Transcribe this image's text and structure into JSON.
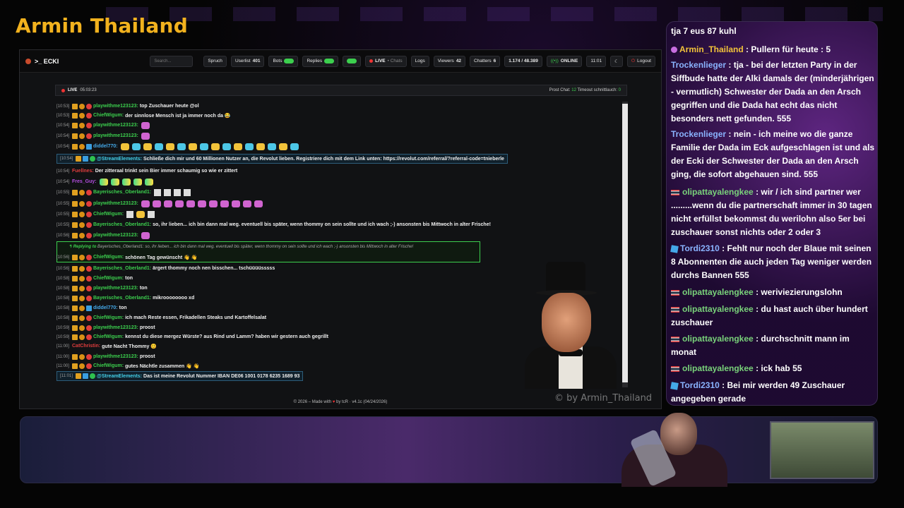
{
  "stage_title": "Armin Thailand",
  "watermark": "© by Armin_Thailand",
  "app": {
    "logo": ">_ ECKI",
    "search_placeholder": "Search...",
    "buttons": {
      "spruch": "Spruch",
      "userlist": "Userlist",
      "userlist_count": "401",
      "bots": "Bots",
      "replies": "Replies",
      "live": "LIVE",
      "chats": "• Chats",
      "logs": "Logs",
      "viewers": "Viewers",
      "viewers_count": "42",
      "chatters": "Chatters",
      "chatters_count": "6",
      "messages": "1.174 / 48.389",
      "status": "ONLINE",
      "time": "11:01",
      "logout": "Logout"
    },
    "chat_header": {
      "live_label": "LIVE",
      "live_time": "05:03:23",
      "info_prefix": "Prost Chat:",
      "info_value": "12",
      "info_suffix": "Timeout schnittlauch:",
      "info_value2": "0"
    },
    "footer": {
      "prefix": "© 2026 – Made with",
      "heart": "♥",
      "suffix": "by tcR · v4.1c (04/24/2026)"
    }
  },
  "messages": [
    {
      "ts": "[10:53]",
      "user": "playwithme123123",
      "color": "#3ccf4e",
      "text": "top Zuschauer heute @ol"
    },
    {
      "ts": "[10:53]",
      "user": "ChiefWigum",
      "color": "#3ccf4e",
      "text": "der sinnlose Mensch ist ja immer noch da 😂"
    },
    {
      "ts": "[10:54]",
      "user": "playwithme123123",
      "color": "#3ccf4e",
      "text": ""
    },
    {
      "ts": "[10:54]",
      "user": "playwithme123123",
      "color": "#3ccf4e",
      "text": ""
    },
    {
      "ts": "[10:54]",
      "user": "diddel770",
      "color": "#44a8e8",
      "text": ""
    },
    {
      "ts": "[10:54]",
      "user": "@StreamElements",
      "color": "#44d0e8",
      "text": "Schließe dich mir und 60 Millionen Nutzer an, die Revolut lieben. Registriere dich mit dem Link unten: https://revolut.com/referral/?referral-code=tnieberle"
    },
    {
      "ts": "[10:54]",
      "user": "Fuellnes",
      "color": "#e03d3d",
      "text": "Der zitteraal trinkt sein Bier immer schaumig so wie er zittert"
    },
    {
      "ts": "[10:54]",
      "user": "Fres_Guy",
      "color": "#b34de0",
      "text": ""
    },
    {
      "ts": "[10:55]",
      "user": "Bayerisches_Oberland1",
      "color": "#3ccf4e",
      "text": ""
    },
    {
      "ts": "[10:55]",
      "user": "playwithme123123",
      "color": "#3ccf4e",
      "text": ""
    },
    {
      "ts": "[10:55]",
      "user": "ChiefWigum",
      "color": "#3ccf4e",
      "text": ""
    },
    {
      "ts": "[10:55]",
      "user": "Bayerisches_Oberland1",
      "color": "#3ccf4e",
      "text": "so, ihr lieben... ich bin dann mal weg. eventuell bis später, wenn thommy on sein sollte und ich wach ;-) ansonsten bis Mittwoch in alter Frische!"
    },
    {
      "ts": "[10:56]",
      "user": "playwithme123123",
      "color": "#3ccf4e",
      "text": ""
    },
    {
      "ts": "[10:56]",
      "user": "ChiefWigum",
      "color": "#3ccf4e",
      "text": "schönen Tag gewünscht 👋 👋"
    },
    {
      "ts": "[10:56]",
      "user": "Bayerisches_Oberland1",
      "color": "#3ccf4e",
      "text": "ärgert thommy noch nen bisschen... tschüüüüsssss"
    },
    {
      "ts": "[10:58]",
      "user": "ChiefWigum",
      "color": "#3ccf4e",
      "text": "ton"
    },
    {
      "ts": "[10:58]",
      "user": "playwithme123123",
      "color": "#3ccf4e",
      "text": "ton"
    },
    {
      "ts": "[10:58]",
      "user": "Bayerisches_Oberland1",
      "color": "#3ccf4e",
      "text": "mikroooooooo xd"
    },
    {
      "ts": "[10:58]",
      "user": "diddel770",
      "color": "#44a8e8",
      "text": "ton"
    },
    {
      "ts": "[10:58]",
      "user": "ChiefWigum",
      "color": "#3ccf4e",
      "text": "ich mach Reste essen, Frikadellen Steaks und Kartoffelsalat"
    },
    {
      "ts": "[10:59]",
      "user": "playwithme123123",
      "color": "#3ccf4e",
      "text": "proost"
    },
    {
      "ts": "[10:59]",
      "user": "ChiefWigum",
      "color": "#3ccf4e",
      "text": "kennst du diese mergez Würste? aus Rind und Lamm? haben wir gestern auch gegrillt"
    },
    {
      "ts": "[11:00]",
      "user": "CatChristin",
      "color": "#e03d3d",
      "text": "gute Nacht Thommy 😊"
    },
    {
      "ts": "[11:00]",
      "user": "playwithme123123",
      "color": "#3ccf4e",
      "text": "proost"
    },
    {
      "ts": "[11:00]",
      "user": "ChiefWigum",
      "color": "#3ccf4e",
      "text": "gutes Nächtle zusammen 👋 👋"
    },
    {
      "ts": "[11:01]",
      "user": "@StreamElements",
      "color": "#44d0e8",
      "text": "Das ist meine Revolut Nummer IBAN DE06 1001 0178 6235 1689 93"
    }
  ],
  "reply": {
    "label": "Replying to",
    "target": "Bayerisches_Oberland1",
    "quote": ": so, ihr lieben... ich bin dann mal weg. eventuell bis später, wenn thommy on sein sollte und ich wach ;-) ansonsten bis Mittwoch in alter Frische!"
  },
  "overlay": [
    {
      "user": "",
      "color": "#fff",
      "text": "tja 7 eus 87 kuhl"
    },
    {
      "user": "Armin_Thailand",
      "color": "#f2c33a",
      "text": ": Pullern für heute : 5"
    },
    {
      "user": "Trockenlieger",
      "color": "#8ab4ff",
      "text": ": tja - bei der letzten Party in der Siffbude hatte der Alki damals der (minderjährigen - vermutlich) Schwester der Dada an den Arsch gegriffen und die Dada hat echt das nicht besonders nett gefunden. 555"
    },
    {
      "user": "Trockenlieger",
      "color": "#8ab4ff",
      "text": ": nein - ich meine wo die ganze Familie der Dada im Eck aufgeschlagen ist und als der Ecki der Schwester der Dada an den Arsch ging, die sofort abgehauen sind. 555"
    },
    {
      "user": "olipattayalengkee",
      "color": "#79d27a",
      "text": ": wir / ich sind partner wer .........wenn du die partnerschaft immer in 30 tagen nicht erfüllst bekommst du werilohn also 5er bei zuschauer sonst nichts oder 2 oder 3"
    },
    {
      "user": "Tordi2310",
      "color": "#8ab4ff",
      "text": ": Fehlt nur noch der Blaue mit seinen 8 Abonnenten die auch jeden Tag weniger werden durchs Bannen 555"
    },
    {
      "user": "olipattayalengkee",
      "color": "#79d27a",
      "text": ": weriviezierungslohn"
    },
    {
      "user": "olipattayalengkee",
      "color": "#79d27a",
      "text": ": du hast auch über hundert zuschauer"
    },
    {
      "user": "olipattayalengkee",
      "color": "#79d27a",
      "text": ": durchschnitt mann im monat"
    },
    {
      "user": "olipattayalengkee",
      "color": "#79d27a",
      "text": ": ick hab 55"
    },
    {
      "user": "Tordi2310",
      "color": "#8ab4ff",
      "text": ": Bei mir werden 49 Zuschauer angegeben gerade"
    }
  ]
}
